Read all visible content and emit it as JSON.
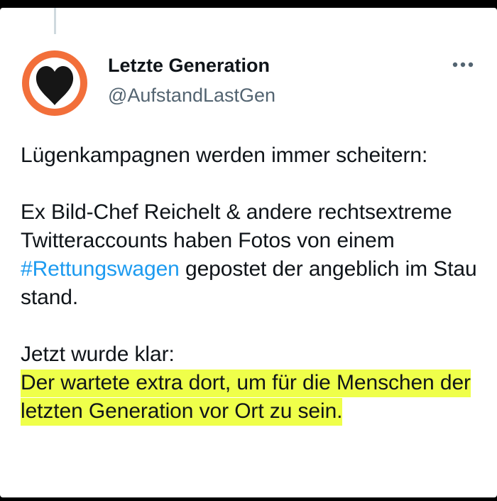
{
  "account": {
    "display_name": "Letzte Generation",
    "handle": "@AufstandLastGen",
    "avatar_icon": "heart-in-circle-icon",
    "avatar_colors": {
      "ring": "#f26f3a",
      "heart": "#161616",
      "background": "#ffffff"
    }
  },
  "more_icon": "more-horizontal-icon",
  "tweet": {
    "paragraph_1": "Lügenkampagnen werden immer scheitern:",
    "paragraph_2_before_hashtag": "Ex Bild-Chef Reichelt & andere rechtsextreme Twitteraccounts haben Fotos von einem ",
    "hashtag": "#Rettungswagen",
    "paragraph_2_after_hashtag": " gepostet der angeblich im Stau stand.",
    "paragraph_3_intro": "Jetzt wurde klar:",
    "highlighted_text": "Der wartete extra dort, um für die Menschen der letzten Generation vor Ort zu sein."
  },
  "colors": {
    "hashtag": "#1d9bf0",
    "highlight": "#efff4a",
    "text": "#0f1419",
    "secondary_text": "#536471"
  }
}
